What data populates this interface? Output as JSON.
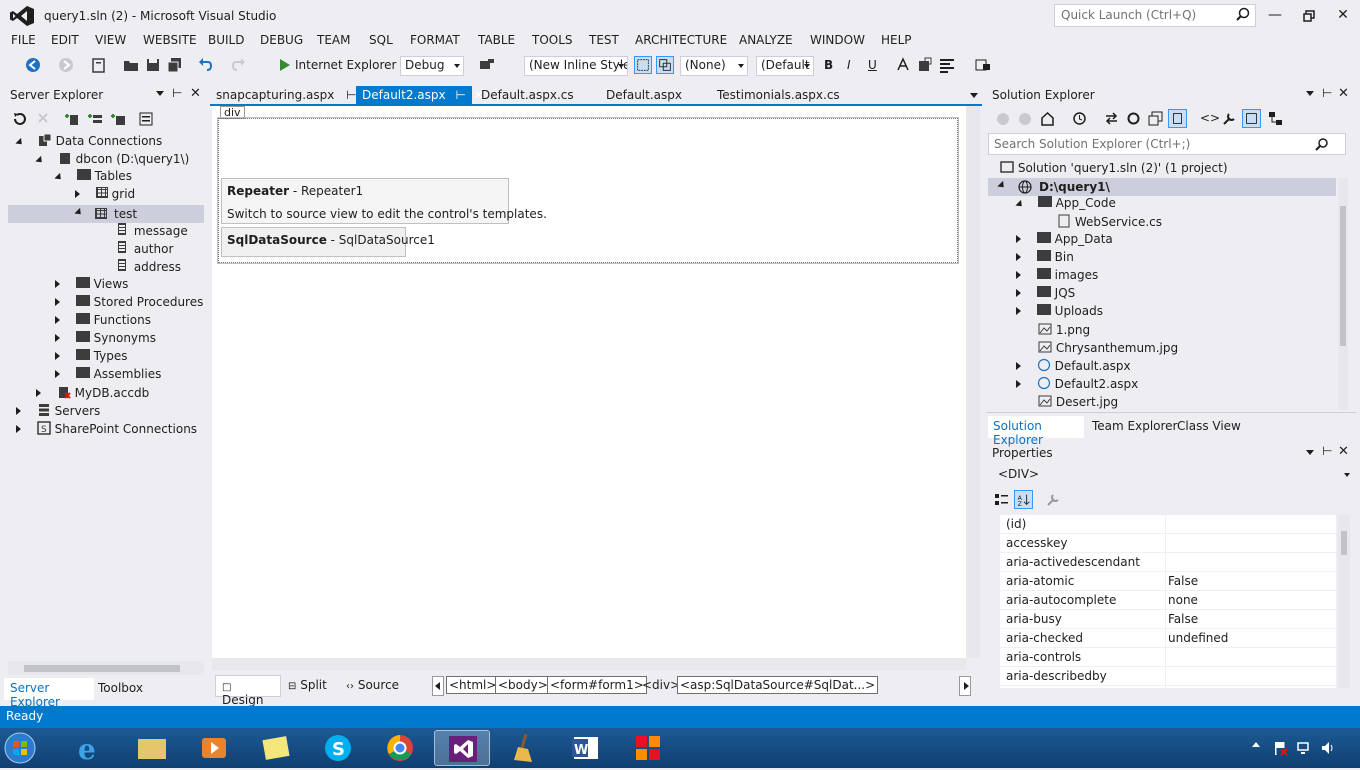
{
  "window": {
    "title": "query1.sln (2) - Microsoft Visual Studio",
    "quick_launch_placeholder": "Quick Launch (Ctrl+Q)"
  },
  "menu": [
    "FILE",
    "EDIT",
    "VIEW",
    "WEBSITE",
    "BUILD",
    "DEBUG",
    "TEAM",
    "SQL",
    "FORMAT",
    "TABLE",
    "TOOLS",
    "TEST",
    "ARCHITECTURE",
    "ANALYZE",
    "WINDOW",
    "HELP"
  ],
  "toolbar": {
    "run_target": "Internet Explorer",
    "config": "Debug",
    "style": "(New Inline Style",
    "target_rule": "(None)",
    "font": "(Default",
    "bold": "B",
    "italic": "I",
    "underline": "U"
  },
  "server_explorer": {
    "title": "Server Explorer",
    "items": {
      "data_connections": "Data Connections",
      "dbcon": "dbcon (D:\\query1\\)",
      "tables": "Tables",
      "grid": "grid",
      "test": "test",
      "message": "message",
      "author": "author",
      "address": "address",
      "views": "Views",
      "stored_procedures": "Stored Procedures",
      "functions": "Functions",
      "synonyms": "Synonyms",
      "types": "Types",
      "assemblies": "Assemblies",
      "mydb": "MyDB.accdb",
      "servers": "Servers",
      "sharepoint": "SharePoint Connections"
    },
    "bottom_tabs": [
      "Server Explorer",
      "Toolbox"
    ]
  },
  "doc_tabs": [
    "snapcapturing.aspx",
    "Default2.aspx",
    "Default.aspx.cs",
    "Default.aspx",
    "Testimonials.aspx.cs"
  ],
  "designer": {
    "div_tag": "div",
    "repeater_title": "Repeater",
    "repeater_name": " - Repeater1",
    "repeater_hint": "Switch to source view to edit the control's templates.",
    "sqlds_title": "SqlDataSource",
    "sqlds_name": " - SqlDataSource1",
    "view_tabs": [
      "Design",
      "Split",
      "Source"
    ],
    "breadcrumb": [
      "<html>",
      "<body>",
      "<form#form1>",
      "<div>",
      "<asp:SqlDataSource#SqlDat...>"
    ]
  },
  "solution_explorer": {
    "title": "Solution Explorer",
    "search_placeholder": "Search Solution Explorer (Ctrl+;)",
    "solution": "Solution 'query1.sln (2)' (1 project)",
    "project": "D:\\query1\\",
    "items": {
      "app_code": "App_Code",
      "webservice": "WebService.cs",
      "app_data": "App_Data",
      "bin": "Bin",
      "images": "images",
      "jqs": "JQS",
      "uploads": "Uploads",
      "png": "1.png",
      "chrys": "Chrysanthemum.jpg",
      "default_aspx": "Default.aspx",
      "default2_aspx": "Default2.aspx",
      "desert": "Desert.jpg"
    },
    "bottom_tabs": [
      "Solution Explorer",
      "Team Explorer",
      "Class View"
    ]
  },
  "properties": {
    "title": "Properties",
    "object": "<DIV>",
    "rows": [
      {
        "name": "(id)",
        "value": ""
      },
      {
        "name": "accesskey",
        "value": ""
      },
      {
        "name": "aria-activedescendant",
        "value": ""
      },
      {
        "name": "aria-atomic",
        "value": "False"
      },
      {
        "name": "aria-autocomplete",
        "value": "none"
      },
      {
        "name": "aria-busy",
        "value": "False"
      },
      {
        "name": "aria-checked",
        "value": "undefined"
      },
      {
        "name": "aria-controls",
        "value": ""
      },
      {
        "name": "aria-describedby",
        "value": ""
      }
    ]
  },
  "status": {
    "text": "Ready"
  },
  "colors": {
    "accent": "#007acc",
    "chrome": "#eeeef2",
    "vs_purple": "#68217a"
  },
  "icons": [
    "vs-logo-icon",
    "search-icon",
    "minimize-icon",
    "restore-icon",
    "close-icon",
    "back-icon",
    "forward-icon",
    "play-icon",
    "pin-icon",
    "folder-icon",
    "table-icon",
    "column-icon",
    "database-icon",
    "server-icon",
    "sharepoint-icon",
    "globe-icon",
    "image-file-icon",
    "cs-file-icon"
  ]
}
